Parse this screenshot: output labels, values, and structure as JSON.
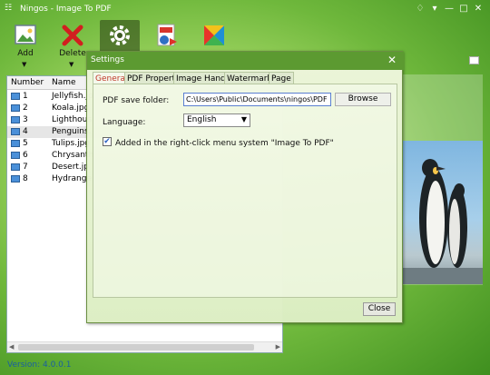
{
  "window": {
    "title": "Ningos - Image To PDF"
  },
  "toolbar": {
    "add_label": "Add",
    "delete_label": "Delete",
    "icons": [
      "image-add-icon",
      "red-x-delete-icon",
      "gear-icon",
      "pdf-convert-icon",
      "app-logo-icon"
    ]
  },
  "list": {
    "headers": {
      "number": "Number",
      "name": "Name"
    },
    "rows": [
      {
        "num": "1",
        "name": "Jellyfish.jp"
      },
      {
        "num": "2",
        "name": "Koala.jpg"
      },
      {
        "num": "3",
        "name": "Lighthous"
      },
      {
        "num": "4",
        "name": "Penguins."
      },
      {
        "num": "5",
        "name": "Tulips.jpg"
      },
      {
        "num": "6",
        "name": "Chrysanth"
      },
      {
        "num": "7",
        "name": "Desert.jp"
      },
      {
        "num": "8",
        "name": "Hydrange"
      }
    ],
    "selected_index": 3
  },
  "version": "Version: 4.0.0.1",
  "settings": {
    "title": "Settings",
    "tabs": [
      "General",
      "PDF Property",
      "Image Handle",
      "Watermark",
      "Page"
    ],
    "active_tab": "General",
    "pdf_save_folder_label": "PDF save folder:",
    "pdf_save_folder_value": "C:\\Users\\Public\\Documents\\ningos\\PDF",
    "browse_label": "Browse",
    "language_label": "Language:",
    "language_value": "English",
    "context_menu_label": "Added in the right-click menu system \"Image To PDF\"",
    "context_menu_checked": true,
    "close_label": "Close"
  },
  "colors": {
    "accent_green": "#5c9a31",
    "active_tab_text": "#c0392b",
    "version_text": "#1a5fa0"
  }
}
